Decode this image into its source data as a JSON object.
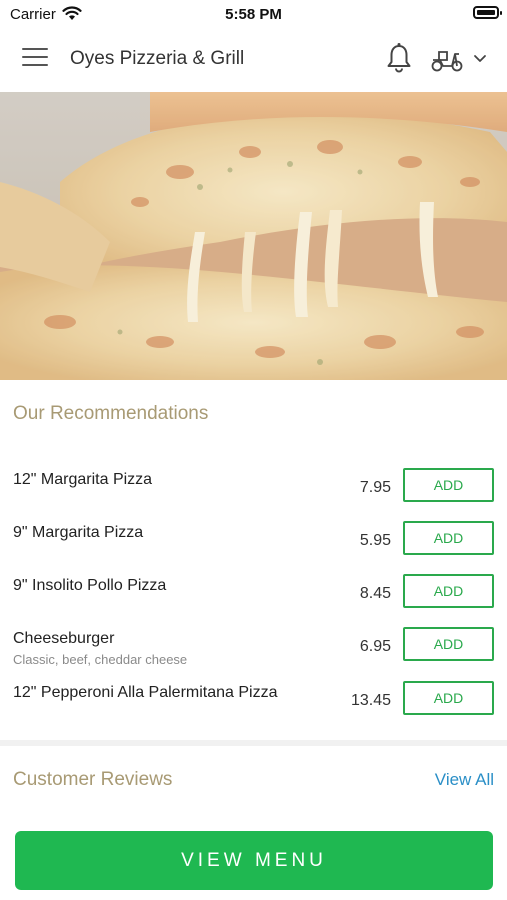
{
  "status_bar": {
    "carrier": "Carrier",
    "time": "5:58 PM"
  },
  "header": {
    "title": "Oyes Pizzeria & Grill"
  },
  "icons": {
    "menu": "hamburger-icon",
    "bell": "bell-icon",
    "delivery": "scooter-icon",
    "dropdown": "chevron-down-icon"
  },
  "colors": {
    "accent_green": "#1fb851",
    "section_title": "#a89a74",
    "link_blue": "#2b8fc7"
  },
  "recommendations": {
    "title": "Our Recommendations",
    "items": [
      {
        "name": "12\" Margarita Pizza",
        "description": "",
        "price": "7.95",
        "button": "ADD"
      },
      {
        "name": "9\" Margarita Pizza",
        "description": "",
        "price": "5.95",
        "button": "ADD"
      },
      {
        "name": "9\" Insolito Pollo Pizza",
        "description": "",
        "price": "8.45",
        "button": "ADD"
      },
      {
        "name": "Cheeseburger",
        "description": "Classic, beef, cheddar cheese",
        "price": "6.95",
        "button": "ADD"
      },
      {
        "name": "12\" Pepperoni Alla Palermitana Pizza",
        "description": "",
        "price": "13.45",
        "button": "ADD"
      }
    ]
  },
  "reviews": {
    "title": "Customer Reviews",
    "view_all": "View All"
  },
  "footer": {
    "view_menu": "VIEW MENU"
  }
}
